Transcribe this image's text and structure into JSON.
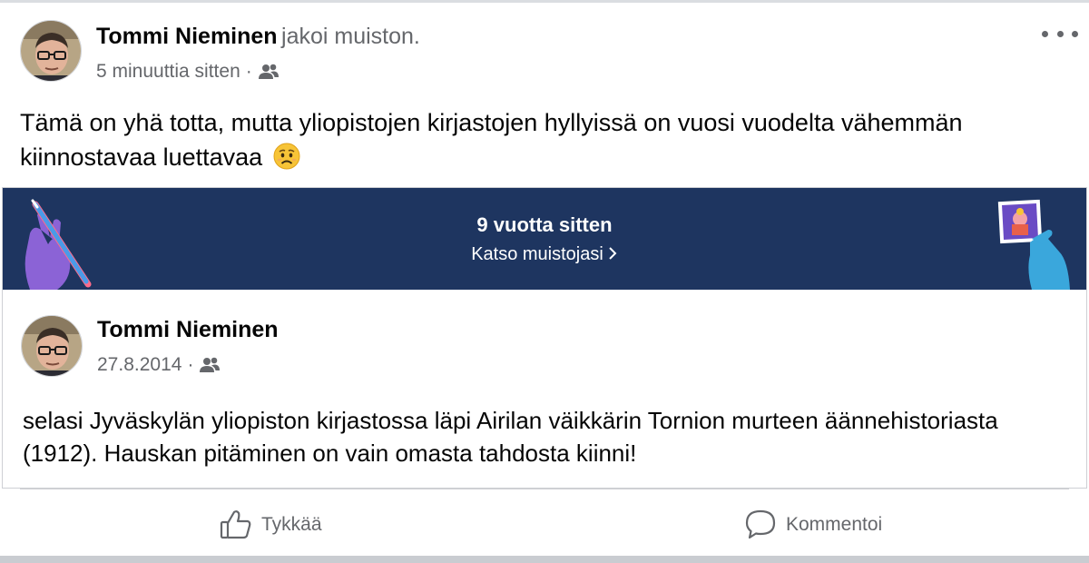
{
  "post": {
    "author": "Tommi Nieminen",
    "action": "jakoi muiston.",
    "time": "5 minuuttia sitten",
    "separator": "·",
    "audience_icon": "friends-icon",
    "menu_icon": "more-horizontal-icon",
    "text": "Tämä on yhä totta, mutta yliopistojen kirjastojen hyllyissä on vuosi vuodelta vähemmän kiinnostavaa luettavaa",
    "emoji": "worried-face-emoji"
  },
  "memory": {
    "title": "9 vuotta sitten",
    "link": "Katso muistojasi",
    "banner_color": "#1e3560"
  },
  "original_post": {
    "author": "Tommi Nieminen",
    "date": "27.8.2014",
    "separator": "·",
    "audience_icon": "friends-icon",
    "text": "selasi Jyväskylän yliopiston kirjastossa läpi Airilan väikkärin Tornion murteen äännehistoriasta (1912). Hauskan pitäminen on vain omasta tahdosta kiinni!"
  },
  "actions": {
    "like": "Tykkää",
    "comment": "Kommentoi"
  }
}
